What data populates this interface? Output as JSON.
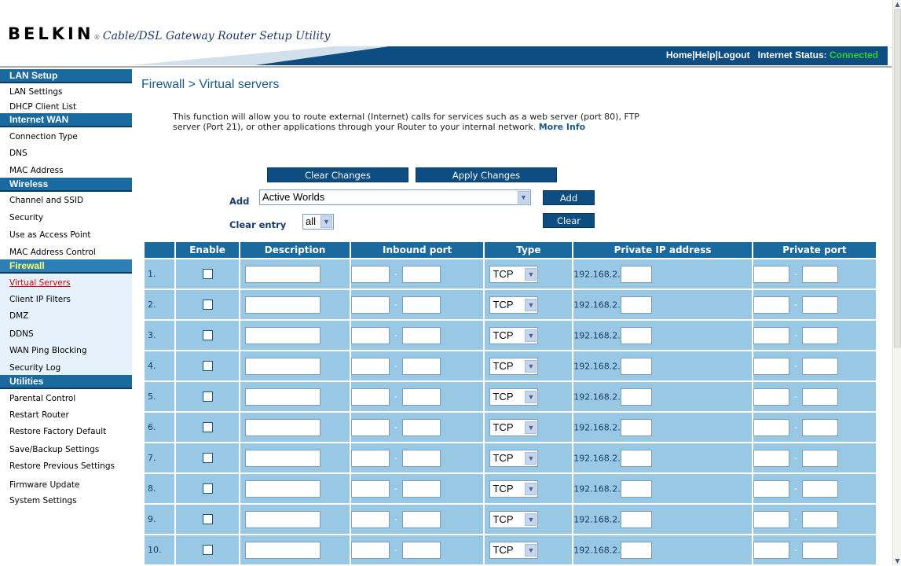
{
  "header": {
    "brand_name": "BELKIN",
    "brand_reg": "®",
    "tagline": "Cable/DSL Gateway Router Setup Utility",
    "links": [
      "Home",
      "Help",
      "Logout"
    ],
    "link_separator": "|",
    "status_label": "Internet Status:",
    "status_value": "Connected",
    "status_color": "#33cc33",
    "bar_color": "#0d4d82"
  },
  "sidebar": {
    "sections": [
      {
        "title": "LAN Setup",
        "items": [
          "LAN Settings",
          "DHCP Client List"
        ]
      },
      {
        "title": "Internet WAN",
        "items": [
          "Connection Type",
          "DNS",
          "MAC Address"
        ]
      },
      {
        "title": "Wireless",
        "items": [
          "Channel and SSID",
          "Security",
          "Use as Access Point",
          "MAC Address Control"
        ]
      },
      {
        "title": "Firewall",
        "items": [
          "Virtual Servers",
          "Client IP Filters",
          "DMZ",
          "DDNS",
          "WAN Ping Blocking",
          "Security Log"
        ]
      },
      {
        "title": "Utilities",
        "items": [
          "Parental Control",
          "Restart Router",
          "Restore Factory Default",
          "Save/Backup Settings",
          "Restore Previous Settings",
          "Firmware Update",
          "System Settings"
        ]
      }
    ],
    "active_item": "Virtual Servers"
  },
  "main": {
    "title": "Firewall > Virtual servers",
    "intro": "This function will allow you to route external (Internet) calls for services such as a web server (port 80), FTP server (Port 21), or other applications through your Router to your internal network.",
    "more_info": "More Info",
    "buttons": {
      "clear_changes": "Clear Changes",
      "apply_changes": "Apply Changes",
      "add": "Add",
      "clear": "Clear"
    },
    "add_label": "Add",
    "add_selected": "Active Worlds",
    "clear_entry_label": "Clear entry",
    "clear_entry_selected": "all",
    "table": {
      "headers": [
        "",
        "Enable",
        "Description",
        "Inbound port",
        "Type",
        "Private IP address",
        "Private port"
      ],
      "type_value": "TCP",
      "ip_prefix": "192.168.2.",
      "port_separator": "-",
      "rows": [
        "1.",
        "2.",
        "3.",
        "4.",
        "5.",
        "6.",
        "7.",
        "8.",
        "9.",
        "10."
      ]
    }
  }
}
